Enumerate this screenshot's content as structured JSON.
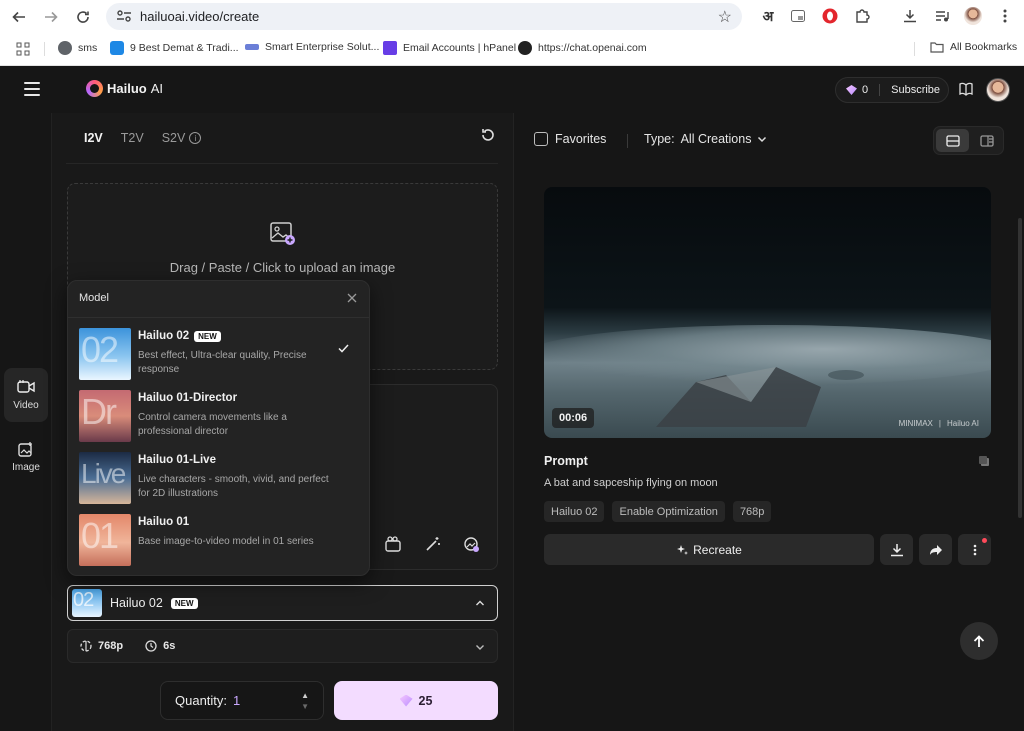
{
  "browser": {
    "url": "hailuoai.video/create",
    "ext_lang": "अ",
    "bookmarks": [
      {
        "label": "sms"
      },
      {
        "label": "9 Best Demat & Tradi..."
      },
      {
        "label": "Smart Enterprise Solut..."
      },
      {
        "label": "Email Accounts | hPanel"
      },
      {
        "label": "https://chat.openai.com"
      }
    ],
    "all_bookmarks": "All Bookmarks"
  },
  "header": {
    "logo_name": "Hailuo",
    "logo_suffix": "AI",
    "credits": "0",
    "subscribe": "Subscribe"
  },
  "rail": {
    "items": [
      {
        "label": "Video"
      },
      {
        "label": "Image"
      }
    ]
  },
  "left": {
    "tabs": [
      {
        "label": "I2V"
      },
      {
        "label": "T2V"
      },
      {
        "label": "S2V"
      }
    ],
    "info_glyph": "i",
    "upload_text": "Drag / Paste / Click to upload an image",
    "model_select": {
      "name": "Hailuo 02",
      "badge": "NEW"
    },
    "params": {
      "resolution": "768p",
      "duration": "6s"
    },
    "quantity_label": "Quantity:",
    "quantity_value": "1",
    "generate_cost": "25"
  },
  "dropdown": {
    "title": "Model",
    "models": [
      {
        "name": "Hailuo 02",
        "badge": "NEW",
        "desc": "Best effect, Ultra-clear quality, Precise response",
        "thumb_text": "02",
        "selected": true
      },
      {
        "name": "Hailuo 01-Director",
        "badge": "",
        "desc": "Control camera movements like a professional director",
        "thumb_text": "Dr"
      },
      {
        "name": "Hailuo 01-Live",
        "badge": "",
        "desc": "Live characters - smooth, vivid, and perfect for 2D illustrations",
        "thumb_text": "Live"
      },
      {
        "name": "Hailuo 01",
        "badge": "",
        "desc": "Base image-to-video model in 01 series",
        "thumb_text": "01"
      }
    ]
  },
  "right": {
    "favorites": "Favorites",
    "type_label": "Type:",
    "type_value": "All Creations",
    "video": {
      "duration": "00:06",
      "watermark_a": "MINIMAX",
      "watermark_b": "Hailuo AI"
    },
    "prompt_heading": "Prompt",
    "prompt_text": "A bat and sapceship flying on moon",
    "chips": [
      "Hailuo 02",
      "Enable Optimization",
      "768p"
    ],
    "recreate": "Recreate"
  },
  "colors": {
    "accent": "#f3dcff",
    "quantity_value": "#c9a8ff",
    "notification": "#ff4a5a"
  }
}
